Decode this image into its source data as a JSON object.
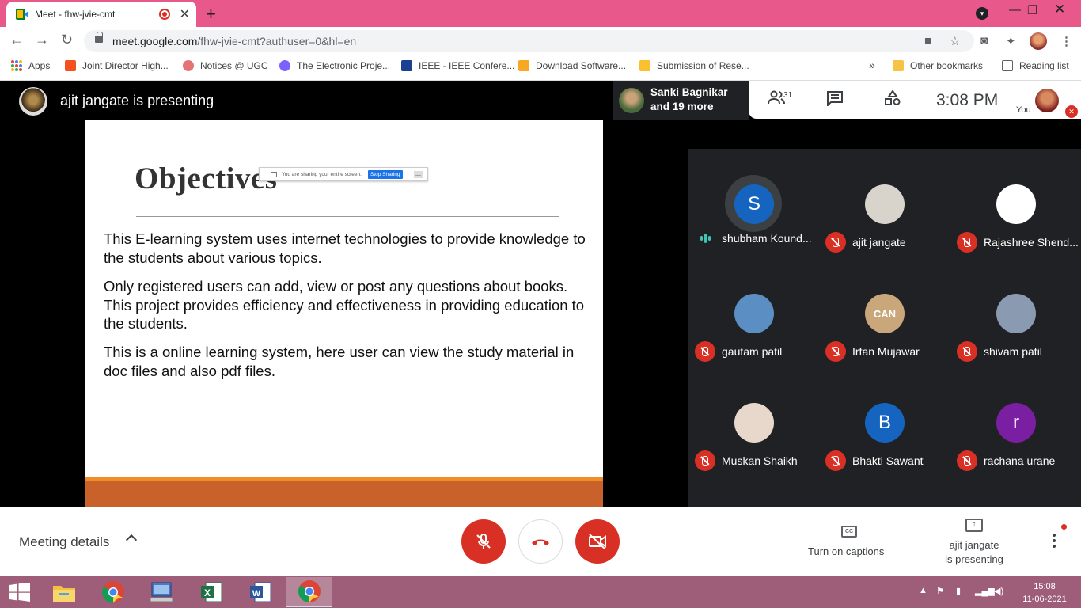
{
  "browser": {
    "tab_title": "Meet - fhw-jvie-cmt",
    "url_host": "meet.google.com",
    "url_path": "/fhw-jvie-cmt?authuser=0&hl=en",
    "bookmarks": [
      {
        "label": "Apps",
        "color": "#4285f4"
      },
      {
        "label": "Joint Director High...",
        "color": "#f4511e"
      },
      {
        "label": "Notices @ UGC",
        "color": "#e57373"
      },
      {
        "label": "The Electronic Proje...",
        "color": "#7b61ff"
      },
      {
        "label": "IEEE - IEEE Confere...",
        "color": "#1c3f94"
      },
      {
        "label": "Download Software...",
        "color": "#f9a825"
      },
      {
        "label": "Submission of Rese...",
        "color": "#fbc02d"
      }
    ],
    "other_bookmarks": "Other bookmarks",
    "reading_list": "Reading list",
    "more_bookmarks": "»"
  },
  "meet": {
    "presenting_title": "ajit jangate is presenting",
    "chip_name": "Sanki Bagnikar",
    "chip_more": "and 19 more",
    "participant_count": "31",
    "clock": "3:08  PM",
    "you_label": "You",
    "share_notice": "You are sharing your entire screen.",
    "stop_sharing": "Stop Sharing",
    "hide_label": "__"
  },
  "slide": {
    "title": "Objectives",
    "paragraphs": [
      "This E-learning system uses internet technologies to provide knowledge to the students about various topics.",
      "Only registered users can add, view or post any questions about books. This project provides efficiency and effectiveness in providing education to the students.",
      "This is a online learning system, here user can view the study material in doc files and also pdf files."
    ]
  },
  "participants": [
    {
      "name": "shubham Kound...",
      "initial": "S",
      "bg": "#1565c0",
      "speaking": true
    },
    {
      "name": "ajit jangate",
      "initial": "",
      "bg": "#d8d4cc",
      "speaking": false
    },
    {
      "name": "Rajashree Shend...",
      "initial": "",
      "bg": "#ffffff",
      "speaking": false
    },
    {
      "name": "gautam patil",
      "initial": "",
      "bg": "#5b8fc4",
      "speaking": false
    },
    {
      "name": "Irfan Mujawar",
      "initial": "CAN",
      "bg": "#c9a77a",
      "speaking": false
    },
    {
      "name": "shivam patil",
      "initial": "",
      "bg": "#8a9ab0",
      "speaking": false
    },
    {
      "name": "Muskan Shaikh",
      "initial": "",
      "bg": "#e8d8cc",
      "speaking": false
    },
    {
      "name": "Bhakti Sawant",
      "initial": "B",
      "bg": "#1565c0",
      "speaking": false
    },
    {
      "name": "rachana urane",
      "initial": "r",
      "bg": "#7b1fa2",
      "speaking": false
    }
  ],
  "controls": {
    "meeting_details": "Meeting details",
    "captions": "Turn on captions",
    "presenting_line1": "ajit jangate",
    "presenting_line2": "is presenting"
  },
  "taskbar": {
    "time": "15:08",
    "date": "11-06-2021"
  }
}
